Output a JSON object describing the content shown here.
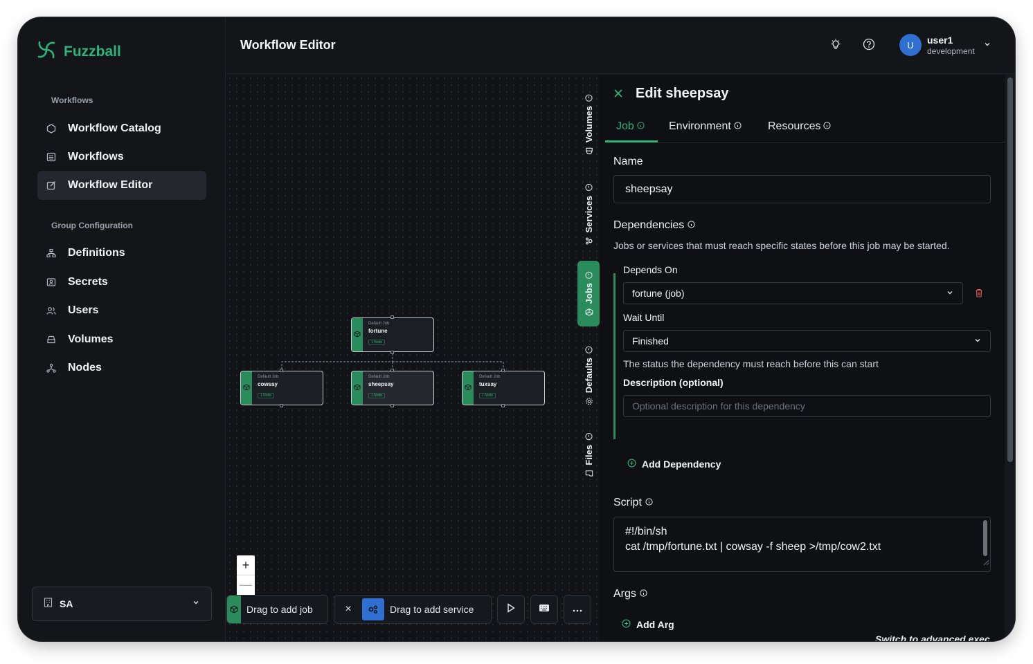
{
  "brand": {
    "name": "Fuzzball"
  },
  "sidebar": {
    "sections": [
      {
        "label": "Workflows"
      },
      {
        "label": "Group Configuration"
      }
    ],
    "items": [
      {
        "label": "Workflow Catalog",
        "icon": "hexagon-icon"
      },
      {
        "label": "Workflows",
        "icon": "list-icon"
      },
      {
        "label": "Workflow Editor",
        "icon": "edit-icon",
        "active": true
      },
      {
        "label": "Definitions",
        "icon": "hierarchy-icon"
      },
      {
        "label": "Secrets",
        "icon": "key-card-icon"
      },
      {
        "label": "Users",
        "icon": "users-icon"
      },
      {
        "label": "Volumes",
        "icon": "drive-icon"
      },
      {
        "label": "Nodes",
        "icon": "nodes-icon"
      }
    ],
    "org": {
      "label": "SA"
    }
  },
  "header": {
    "title": "Workflow Editor",
    "user": {
      "initial": "U",
      "name": "user1",
      "env": "development"
    }
  },
  "canvas": {
    "nodes": [
      {
        "type": "Default Job",
        "name": "fortune",
        "badge": "1 Node"
      },
      {
        "type": "Default Job",
        "name": "cowsay",
        "badge": "1 Node"
      },
      {
        "type": "Default Job",
        "name": "sheepsay",
        "badge": "1 Node",
        "selected": true
      },
      {
        "type": "Default Job",
        "name": "tuxsay",
        "badge": "1 Node"
      }
    ],
    "zoom": {
      "in": "+",
      "out": "—"
    },
    "toolbar": {
      "add_job": "Drag to add job",
      "close": "×",
      "add_service": "Drag to add service"
    }
  },
  "vtabs": [
    {
      "label": "Volumes"
    },
    {
      "label": "Services"
    },
    {
      "label": "Jobs",
      "active": true
    },
    {
      "label": "Defaults"
    },
    {
      "label": "Files"
    }
  ],
  "panel": {
    "title": "Edit sheepsay",
    "tabs": [
      {
        "label": "Job",
        "active": true
      },
      {
        "label": "Environment"
      },
      {
        "label": "Resources"
      }
    ],
    "name_label": "Name",
    "name_value": "sheepsay",
    "dependencies": {
      "label": "Dependencies",
      "help": "Jobs or services that must reach specific states before this job may be started.",
      "depends_on_label": "Depends On",
      "depends_on_value": "fortune (job)",
      "wait_until_label": "Wait Until",
      "wait_until_value": "Finished",
      "wait_help": "The status the dependency must reach before this can start",
      "description_label": "Description (optional)",
      "description_placeholder": "Optional description for this dependency",
      "add_label": "Add Dependency"
    },
    "script": {
      "label": "Script",
      "line1": "#!/bin/sh",
      "line2": "cat /tmp/fortune.txt | cowsay -f sheep >/tmp/cow2.txt"
    },
    "args": {
      "label": "Args",
      "add_label": "Add Arg"
    },
    "advanced": "Switch to advanced exec"
  },
  "colors": {
    "accent": "#2fb37a",
    "accent_dark": "#2a8b5c",
    "avatar": "#2f6fd1",
    "danger": "#e25c5c"
  }
}
